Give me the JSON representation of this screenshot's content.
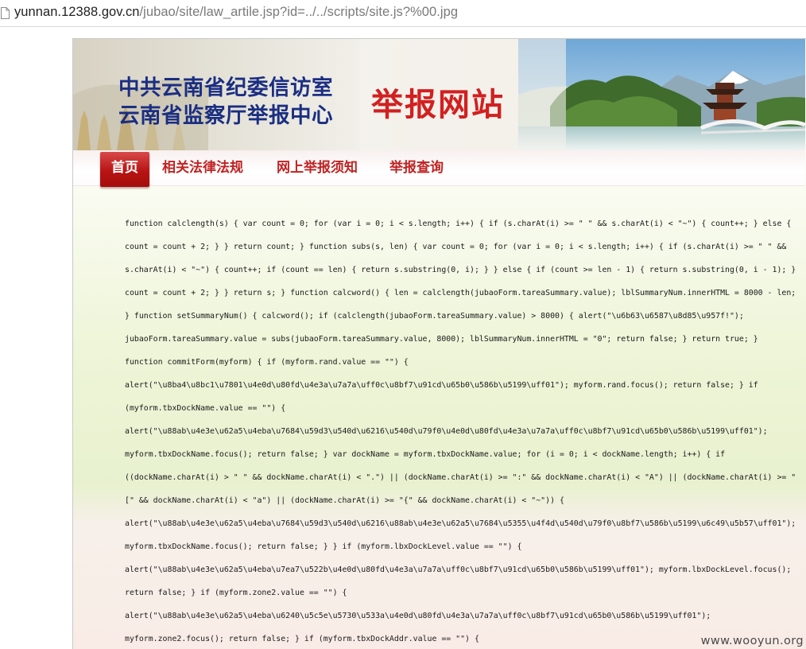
{
  "browser": {
    "url_host": "yunnan.12388.gov.cn",
    "url_path": "/jubao/site/law_artile.jsp?id=../../scripts/site.js?%00.jpg",
    "page_icon": "document-icon"
  },
  "banner": {
    "title_line_1": "中共云南省纪委信访室",
    "title_line_2": "云南省监察厅举报中心",
    "site_name": "举报网站"
  },
  "nav": {
    "items": [
      {
        "label": "首页",
        "active": true
      },
      {
        "label": "相关法律法规",
        "active": false
      },
      {
        "label": "网上举报须知",
        "active": false
      },
      {
        "label": "举报查询",
        "active": false
      }
    ]
  },
  "code_lines": [
    "function calclength(s) { var count = 0; for (var i = 0; i < s.length; i++) { if (s.charAt(i) >= \" \" && s.charAt(i) < \"~\") { count++; } else {",
    "count = count + 2; } } return count; } function subs(s, len) { var count = 0; for (var i = 0; i < s.length; i++) { if (s.charAt(i) >= \" \" &&",
    "s.charAt(i) < \"~\") { count++; if (count == len) { return s.substring(0, i); } } else { if (count >= len - 1) { return s.substring(0, i - 1); }",
    "count = count + 2; } } return s; } function calcword() { len = calclength(jubaoForm.tareaSummary.value); lblSummaryNum.innerHTML = 8000 - len;",
    "} function setSummaryNum() { calcword(); if (calclength(jubaoForm.tareaSummary.value) > 8000) { alert(\"\\u6b63\\u6587\\u8d85\\u957f!\");",
    "jubaoForm.tareaSummary.value = subs(jubaoForm.tareaSummary.value, 8000); lblSummaryNum.innerHTML = \"0\"; return false; } return true; }",
    "function commitForm(myform) { if (myform.rand.value == \"\") {",
    "alert(\"\\u8ba4\\u8bc1\\u7801\\u4e0d\\u80fd\\u4e3a\\u7a7a\\uff0c\\u8bf7\\u91cd\\u65b0\\u586b\\u5199\\uff01\"); myform.rand.focus(); return false; } if",
    "(myform.tbxDockName.value == \"\") {",
    "alert(\"\\u88ab\\u4e3e\\u62a5\\u4eba\\u7684\\u59d3\\u540d\\u6216\\u540d\\u79f0\\u4e0d\\u80fd\\u4e3a\\u7a7a\\uff0c\\u8bf7\\u91cd\\u65b0\\u586b\\u5199\\uff01\");",
    "myform.tbxDockName.focus(); return false; } var dockName = myform.tbxDockName.value; for (i = 0; i < dockName.length; i++) { if",
    "((dockName.charAt(i) > \" \" && dockName.charAt(i) < \".\") || (dockName.charAt(i) >= \":\" && dockName.charAt(i) < \"A\") || (dockName.charAt(i) >= \"",
    "[\" && dockName.charAt(i) < \"a\") || (dockName.charAt(i) >= \"{\" && dockName.charAt(i) < \"~\")) {",
    "alert(\"\\u88ab\\u4e3e\\u62a5\\u4eba\\u7684\\u59d3\\u540d\\u6216\\u88ab\\u4e3e\\u62a5\\u7684\\u5355\\u4f4d\\u540d\\u79f0\\u8bf7\\u586b\\u5199\\u6c49\\u5b57\\uff01\");",
    "myform.tbxDockName.focus(); return false; } } if (myform.lbxDockLevel.value == \"\") {",
    "alert(\"\\u88ab\\u4e3e\\u62a5\\u4eba\\u7ea7\\u522b\\u4e0d\\u80fd\\u4e3a\\u7a7a\\uff0c\\u8bf7\\u91cd\\u65b0\\u586b\\u5199\\uff01\"); myform.lbxDockLevel.focus();",
    "return false; } if (myform.zone2.value == \"\") {",
    "alert(\"\\u88ab\\u4e3e\\u62a5\\u4eba\\u6240\\u5c5e\\u5730\\u533a\\u4e0d\\u80fd\\u4e3a\\u7a7a\\uff0c\\u8bf7\\u91cd\\u65b0\\u586b\\u5199\\uff01\");",
    "myform.zone2.focus(); return false; } if (myform.tbxDockAddr.value == \"\") {"
  ],
  "watermark": "www.wooyun.org"
}
